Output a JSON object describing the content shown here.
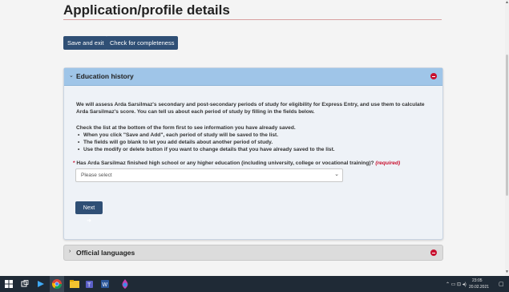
{
  "page": {
    "title": "Application/profile details",
    "buttons": {
      "save_exit": "Save and exit",
      "check": "Check for completeness"
    }
  },
  "education": {
    "title": "Education history",
    "intro_line1": "We will assess Arda Sarsilmaz's secondary and post-secondary periods of study for eligibility for Express Entry, and use them to calculate",
    "intro_line2": "Arda Sarsilmaz's score. You can tell us about each period of study by filling in the fields below.",
    "check_line": "Check the list at the bottom of the form first to see information you have already saved.",
    "bullets": [
      "When you click \"Save and Add\", each period of study will be saved to the list.",
      "The fields will go blank to let you add details about another period of study.",
      "Use the modify or delete button if you want to change details that you have already saved to the list."
    ],
    "question": "Has Arda Sarsilmaz finished high school or any higher education (including university, college or vocational training)?",
    "required": "(required)",
    "required_star": "*",
    "select_value": "Please select",
    "next_label": "Next ➜"
  },
  "languages": {
    "title": "Official languages"
  },
  "taskbar": {
    "time": "23:05",
    "date": "20.02.2021"
  },
  "colors": {
    "primary_button": "#2f4f75",
    "panel_header": "#9fc5e8",
    "required": "#c8102e"
  },
  "icons": [
    "windows-start-icon",
    "task-view-icon",
    "chrome-icon",
    "file-explorer-icon",
    "teams-icon",
    "word-icon",
    "edge-icon"
  ]
}
